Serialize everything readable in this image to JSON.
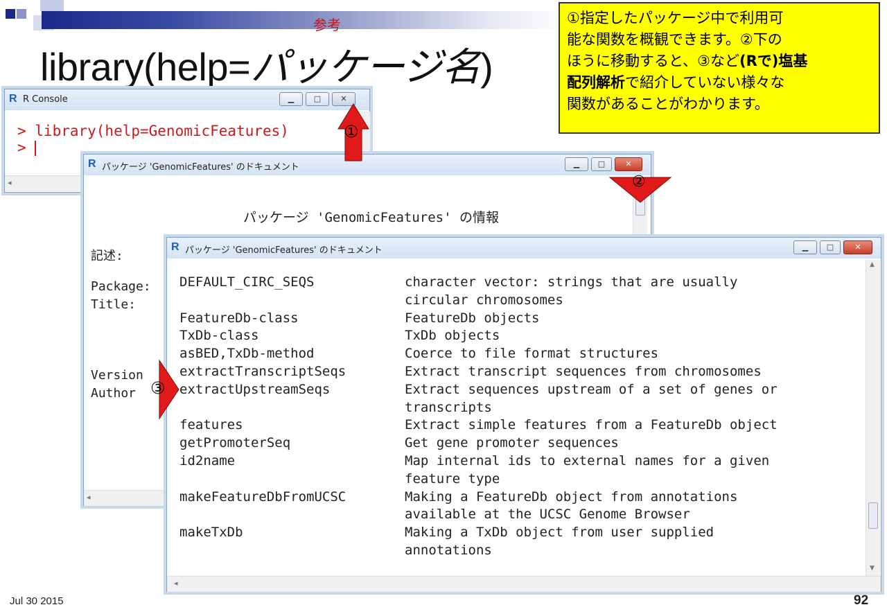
{
  "slide": {
    "sanko": "参考",
    "title_prefix": "library(help=",
    "title_italic": "パッケージ名",
    "title_suffix": ")",
    "note_lines": [
      "①指定したパッケージ中で利用可",
      "能な関数を概観できます。②下の",
      "ほうに移動すると、③など(Rで)塩基",
      "配列解析で紹介していない様々な",
      "関数があることがわかります。"
    ],
    "footer_date": "Jul 30 2015",
    "page_number": "92"
  },
  "markers": {
    "m1": "①",
    "m2": "②",
    "m3": "③"
  },
  "console": {
    "title": "R Console",
    "logo": "R",
    "line1": "> library(help=GenomicFeatures)",
    "line2_prompt": "> "
  },
  "doc1": {
    "title": "パッケージ 'GenomicFeatures' のドキュメント",
    "heading": "パッケージ 'GenomicFeatures' の情報",
    "labels": [
      "記述:",
      "Package:",
      "Title:",
      "Version",
      "Author"
    ]
  },
  "doc2": {
    "title": "パッケージ 'GenomicFeatures' のドキュメント",
    "entries": [
      {
        "name": "DEFAULT_CIRC_SEQS",
        "desc": "character vector: strings that are usually"
      },
      {
        "name": "",
        "desc": "circular chromosomes"
      },
      {
        "name": "FeatureDb-class",
        "desc": "FeatureDb objects"
      },
      {
        "name": "TxDb-class",
        "desc": "TxDb objects"
      },
      {
        "name": "asBED,TxDb-method",
        "desc": "Coerce to file format structures"
      },
      {
        "name": "extractTranscriptSeqs",
        "desc": "Extract transcript sequences from chromosomes"
      },
      {
        "name": "extractUpstreamSeqs",
        "desc": "Extract sequences upstream of a set of genes or"
      },
      {
        "name": "",
        "desc": "transcripts"
      },
      {
        "name": "features",
        "desc": "Extract simple features from a FeatureDb object"
      },
      {
        "name": "getPromoterSeq",
        "desc": "Get gene promoter sequences"
      },
      {
        "name": "id2name",
        "desc": "Map internal ids to external names for a given"
      },
      {
        "name": "",
        "desc": "feature type"
      },
      {
        "name": "makeFeatureDbFromUCSC",
        "desc": "Making a FeatureDb object from annotations"
      },
      {
        "name": "",
        "desc": "available at the UCSC Genome Browser"
      },
      {
        "name": "makeTxDb",
        "desc": "Making a TxDb object from user supplied"
      },
      {
        "name": "",
        "desc": "annotations"
      }
    ]
  },
  "colors": {
    "arrow": "#e01a1a",
    "note_bg": "#ffff00",
    "console_text": "#d01818",
    "title_accent": "#1b2a8a"
  }
}
